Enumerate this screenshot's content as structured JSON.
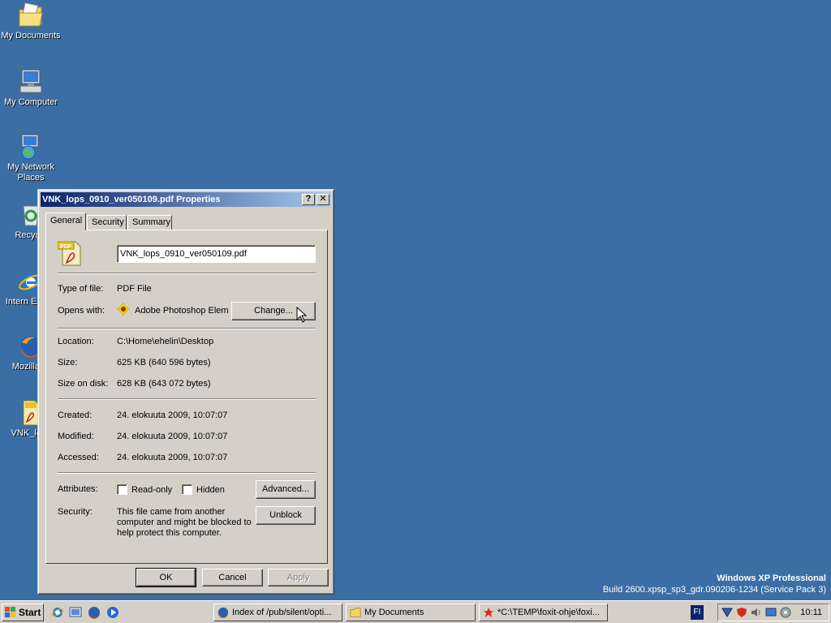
{
  "desktop": {
    "icons": [
      {
        "label": "My Documents"
      },
      {
        "label": "My Computer"
      },
      {
        "label": "My Network Places"
      },
      {
        "label": "Recycle"
      },
      {
        "label": "Intern Explor"
      },
      {
        "label": "Mozilla Fi"
      },
      {
        "label": "VNK_lops"
      }
    ]
  },
  "watermark": {
    "title": "Windows XP Professional",
    "build": "Build 2600.xpsp_sp3_gdr.090206-1234 (Service Pack 3)"
  },
  "dialog": {
    "title": "VNK_lops_0910_ver050109.pdf Properties",
    "help_glyph": "?",
    "close_glyph": "✕",
    "tabs": [
      {
        "label": "General",
        "active": true
      },
      {
        "label": "Security",
        "active": false
      },
      {
        "label": "Summary",
        "active": false
      }
    ],
    "file_icon_text": "PDF",
    "filename": "VNK_lops_0910_ver050109.pdf",
    "type_label": "Type of file:",
    "type_value": "PDF File",
    "opens_label": "Opens with:",
    "opens_value": "Adobe Photoshop Elem",
    "change_button": "Change...",
    "location_label": "Location:",
    "location_value": "C:\\Home\\ehelin\\Desktop",
    "size_label": "Size:",
    "size_value": "625 KB (640 596 bytes)",
    "size_on_disk_label": "Size on disk:",
    "size_on_disk_value": "628 KB (643 072 bytes)",
    "created_label": "Created:",
    "created_value": "24. elokuuta 2009, 10:07:07",
    "modified_label": "Modified:",
    "modified_value": "24. elokuuta 2009, 10:07:07",
    "accessed_label": "Accessed:",
    "accessed_value": "24. elokuuta 2009, 10:07:07",
    "attributes_label": "Attributes:",
    "readonly_label": "Read-only",
    "hidden_label": "Hidden",
    "advanced_button": "Advanced...",
    "security_label": "Security:",
    "security_text": "This file came from another computer and might be blocked to help protect this computer.",
    "unblock_button": "Unblock",
    "ok_button": "OK",
    "cancel_button": "Cancel",
    "apply_button": "Apply"
  },
  "taskbar": {
    "start_label": "Start",
    "tasks": [
      {
        "label": "Index of /pub/silent/opti..."
      },
      {
        "label": "My Documents"
      },
      {
        "label": "*C:\\TEMP\\foxit-ohje\\foxi..."
      }
    ],
    "lang": "FI",
    "clock": "10:11"
  },
  "colors": {
    "desktop": "#3a6ea5",
    "titlebar_start": "#0a246a",
    "titlebar_end": "#a6caf0",
    "face": "#d4d0c8"
  }
}
